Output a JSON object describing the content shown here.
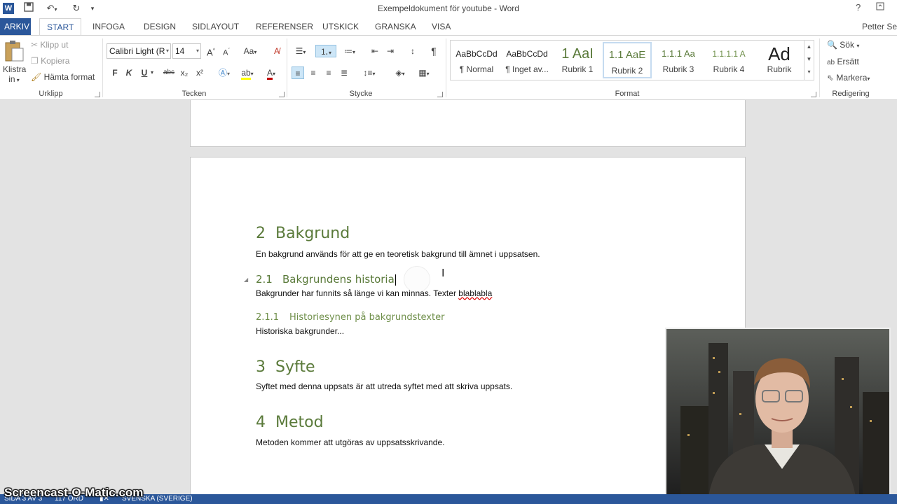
{
  "app": {
    "window_title": "Exempeldokument för youtube - Word",
    "user": "Petter Se",
    "help_label": "?"
  },
  "tabs": [
    {
      "label": "ARKIV"
    },
    {
      "label": "START"
    },
    {
      "label": "INFOGA"
    },
    {
      "label": "DESIGN"
    },
    {
      "label": "SIDLAYOUT"
    },
    {
      "label": "REFERENSER"
    },
    {
      "label": "UTSKICK"
    },
    {
      "label": "GRANSKA"
    },
    {
      "label": "VISA"
    }
  ],
  "ribbon": {
    "clipboard": {
      "label": "Urklipp",
      "paste_line1": "Klistra",
      "paste_line2": "in",
      "cut": "Klipp ut",
      "copy": "Kopiera",
      "format_painter": "Hämta format"
    },
    "font": {
      "label": "Tecken",
      "font_name": "Calibri Light (R",
      "font_size": "14",
      "bold": "F",
      "italic": "K",
      "underline": "U",
      "strike": "abc",
      "subscript": "x₂",
      "superscript": "x²",
      "change_case": "Aa",
      "grow": "A",
      "shrink": "A"
    },
    "paragraph": {
      "label": "Stycke",
      "pilcrow": "¶"
    },
    "styles": {
      "label": "Format",
      "items": [
        {
          "sample": "AaBbCcDd",
          "name": "¶ Normal"
        },
        {
          "sample": "AaBbCcDd",
          "name": "¶ Inget av..."
        },
        {
          "sample": "1  AaI",
          "name": "Rubrik 1"
        },
        {
          "sample": "1.1  AaE",
          "name": "Rubrik 2"
        },
        {
          "sample": "1.1.1  Aa",
          "name": "Rubrik 3"
        },
        {
          "sample": "1.1.1.1  A",
          "name": "Rubrik 4"
        },
        {
          "sample": "Ad",
          "name": "Rubrik"
        }
      ]
    },
    "editing": {
      "label": "Redigering",
      "find": "Sök",
      "replace": "Ersätt",
      "select": "Markera"
    }
  },
  "document": {
    "h1_bakgrund": {
      "num": "2",
      "text": "Bakgrund"
    },
    "p_bakgrund": "En bakgrund används för att ge en teoretisk bakgrund till ämnet i uppsatsen.",
    "h2_historia": {
      "num": "2.1",
      "text": "Bakgrundens historia"
    },
    "p_historia_a": "Bakgrunder har funnits så länge vi kan minnas. Texter ",
    "p_historia_b": "blablabla",
    "h3_historiesynen": {
      "num": "2.1.1",
      "text": "Historiesynen på bakgrundstexter"
    },
    "p_historiesynen": "Historiska bakgrunder...",
    "h1_syfte": {
      "num": "3",
      "text": "Syfte"
    },
    "p_syfte": "Syftet med denna uppsats är att utreda syftet med att skriva uppsats.",
    "h1_metod": {
      "num": "4",
      "text": "Metod"
    },
    "p_metod": "Metoden kommer att utgöras av uppsatsskrivande."
  },
  "statusbar": {
    "page": "SIDA 3 AV 3",
    "words": "117 ORD",
    "language": "SVENSKA (SVERIGE)"
  },
  "overlay": {
    "watermark": "Screencast-O-Matic.com"
  },
  "colors": {
    "accent": "#2b579a",
    "heading": "#5a7a3a",
    "spelling_error": "#dd0000"
  }
}
